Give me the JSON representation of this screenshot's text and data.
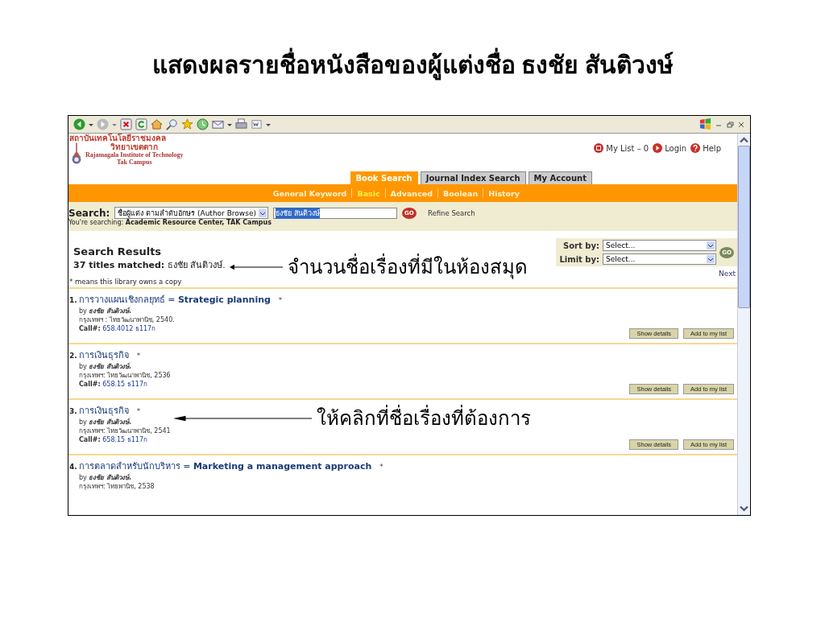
{
  "slide_title": "แสดงผลรายชื่อหนังสือของผู้แต่งชื่อ  ธงชัย  สันติวงษ์",
  "callouts": [
    {
      "text": "จำนวนชื่อเรื่องที่มีในห้องสมุด"
    },
    {
      "text": "ให้คลิกที่ชื่อเรื่องที่ต้องการ"
    }
  ],
  "header": {
    "logo_lines": [
      "สถาบันเทคโนโลยีราชมงคล",
      "วิทยาเขตตาก",
      "Rajamagala Institute of Technology",
      "Tak Campus"
    ],
    "links": [
      {
        "kind": "list",
        "label": "My List – 0"
      },
      {
        "kind": "login",
        "label": "Login"
      },
      {
        "kind": "help",
        "label": "Help"
      }
    ]
  },
  "tabs": [
    {
      "label": "Book Search",
      "selected": true
    },
    {
      "label": "Journal Index Search",
      "selected": false
    },
    {
      "label": "My Account",
      "selected": false
    }
  ],
  "subnav": [
    {
      "label": "General Keyword",
      "selected": false
    },
    {
      "label": "Basic",
      "selected": true
    },
    {
      "label": "Advanced",
      "selected": false
    },
    {
      "label": "Boolean",
      "selected": false
    },
    {
      "label": "History",
      "selected": false
    }
  ],
  "search": {
    "label": "Search:",
    "scope_value": "ชื่อผู้แต่ง ตามลำดับอักษร (Author Browse)",
    "query_value": "ธงชัย สันติวงษ์",
    "go": "GO",
    "refine": "Refine Search",
    "searching_prefix": "You're searching:",
    "searching_location": "Academic Resource Center, TAK Campus"
  },
  "results": {
    "heading": "Search Results",
    "matched_count": "37 titles matched:",
    "matched_name": "ธงชัย สันติวงษ์.",
    "note": "* means this library owns a copy",
    "sort_label": "Sort by:",
    "sort_value": "Select...",
    "limit_label": "Limit by:",
    "limit_value": "Select...",
    "go": "GO",
    "next": "Next"
  },
  "items": [
    {
      "number": "1.",
      "title": "การวางแผนเชิงกลยุทธ์ = **Strategic planning**",
      "mark": "*",
      "by": "by",
      "author": "ธงชัย สันติวงษ์.",
      "publisher": "กรุงเทพฯ : ไทยวัฒนาพานิช, 2540.",
      "call_label": "Call#:",
      "call_number": "658.4012 ธ117ก",
      "buttons": [
        "Show details",
        "Add to my list"
      ]
    },
    {
      "number": "2.",
      "title": "การเงินธุรกิจ",
      "mark": "*",
      "by": "by",
      "author": "ธงชัย สันติวงษ์.",
      "publisher": "กรุงเทพฯ: ไทยวัฒนาพานิช, 2536",
      "call_label": "Call#:",
      "call_number": "658.15 ธ117ก",
      "buttons": [
        "Show details",
        "Add to my list"
      ]
    },
    {
      "number": "3.",
      "title": "การเงินธุรกิจ",
      "mark": "*",
      "by": "by",
      "author": "ธงชัย สันติวงษ์.",
      "publisher": "กรุงเทพฯ: ไทยวัฒนาพานิช, 2541",
      "call_label": "Call#:",
      "call_number": "658.15 ธ117ก",
      "buttons": [
        "Show details",
        "Add to my list"
      ]
    },
    {
      "number": "4.",
      "title": "การตลาดสำหรับนักบริหาร = **Marketing a management approach**",
      "mark": "*",
      "by": "by",
      "author": "ธงชัย สันติวงษ์.",
      "publisher": "กรุงเทพฯ: ไทยพานิช, 2538"
    }
  ]
}
